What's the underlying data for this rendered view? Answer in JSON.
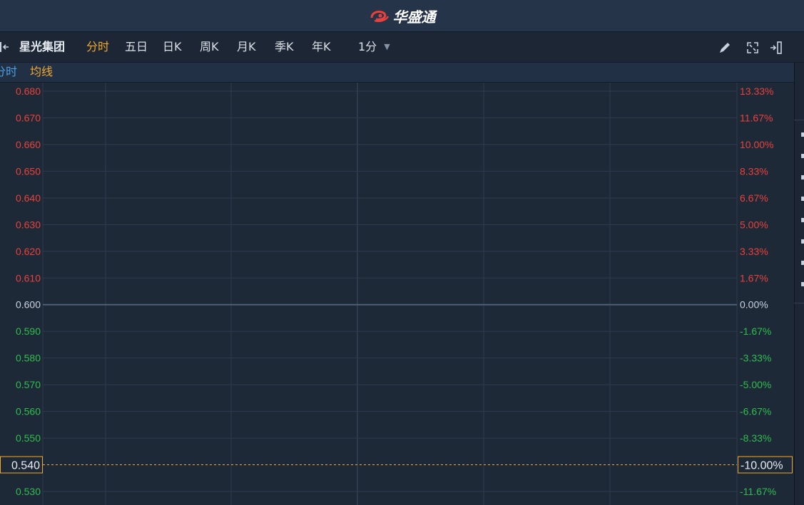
{
  "app": {
    "title": "华盛通"
  },
  "toolbar": {
    "stock_name": "星光集团",
    "tabs": [
      {
        "label": "分时",
        "active": true
      },
      {
        "label": "五日",
        "active": false
      },
      {
        "label": "日K",
        "active": false
      },
      {
        "label": "周K",
        "active": false
      },
      {
        "label": "月K",
        "active": false
      },
      {
        "label": "季K",
        "active": false
      },
      {
        "label": "年K",
        "active": false
      }
    ],
    "period": "1分",
    "icons": [
      "pencil-icon",
      "fullscreen-icon",
      "exit-panel-icon"
    ]
  },
  "subbar": {
    "fenshi": "分时",
    "junxian": "均线"
  },
  "colors": {
    "up": "#e8413b",
    "down": "#2ebd4e",
    "neutral": "#c8d2de",
    "highlight": "#f0a830",
    "grid": "#2e3b4e",
    "zero_line": "#4f6178"
  },
  "chart_data": {
    "type": "line",
    "title": "",
    "xlabel": "",
    "ylabel": "",
    "reference_price": 0.6,
    "ylim": [
      0.525,
      0.6825
    ],
    "grid": true,
    "series": [],
    "y_ticks": [
      {
        "price": "0.680",
        "pct": "13.33%",
        "value": 0.68,
        "trend": "up"
      },
      {
        "price": "0.670",
        "pct": "11.67%",
        "value": 0.67,
        "trend": "up"
      },
      {
        "price": "0.660",
        "pct": "10.00%",
        "value": 0.66,
        "trend": "up"
      },
      {
        "price": "0.650",
        "pct": "8.33%",
        "value": 0.65,
        "trend": "up"
      },
      {
        "price": "0.640",
        "pct": "6.67%",
        "value": 0.64,
        "trend": "up"
      },
      {
        "price": "0.630",
        "pct": "5.00%",
        "value": 0.63,
        "trend": "up"
      },
      {
        "price": "0.620",
        "pct": "3.33%",
        "value": 0.62,
        "trend": "up"
      },
      {
        "price": "0.610",
        "pct": "1.67%",
        "value": 0.61,
        "trend": "up"
      },
      {
        "price": "0.600",
        "pct": "0.00%",
        "value": 0.6,
        "trend": "flat"
      },
      {
        "price": "0.590",
        "pct": "-1.67%",
        "value": 0.59,
        "trend": "down"
      },
      {
        "price": "0.580",
        "pct": "-3.33%",
        "value": 0.58,
        "trend": "down"
      },
      {
        "price": "0.570",
        "pct": "-5.00%",
        "value": 0.57,
        "trend": "down"
      },
      {
        "price": "0.560",
        "pct": "-6.67%",
        "value": 0.56,
        "trend": "down"
      },
      {
        "price": "0.550",
        "pct": "-8.33%",
        "value": 0.55,
        "trend": "down"
      },
      {
        "price": "0.530",
        "pct": "-11.67%",
        "value": 0.53,
        "trend": "down"
      }
    ],
    "crosshair": {
      "price": "0.540",
      "pct": "-10.00%",
      "value": 0.54
    }
  }
}
